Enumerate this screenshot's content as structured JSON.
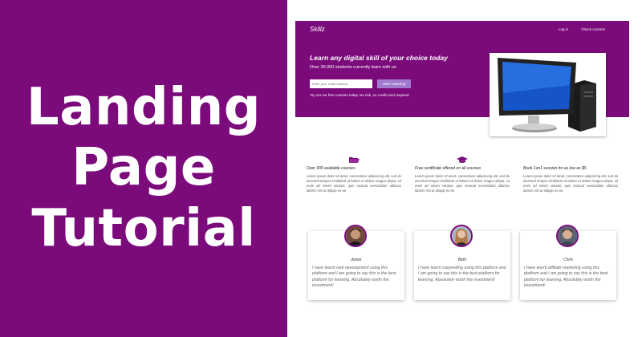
{
  "thumbnail": {
    "title_lines": [
      "Landing",
      "Page",
      "Tutorial"
    ]
  },
  "hero": {
    "brand": "Skillz",
    "nav": [
      "Log in",
      "Check courses"
    ],
    "headline": "Learn any digital skill of your choice today",
    "subheadline": "Over 30,000 students currently learn with us",
    "email_placeholder": "Enter your email address",
    "cta_label": "Start Learning",
    "note": "Try out our free courses today. No risk, no credit card required"
  },
  "features": [
    {
      "icon": "folder-open-icon",
      "title": "Over 300 available courses",
      "text": "Lorem ipsum dolor sit amet, consectetur adipisicing elit, sed do eiusmod tempor incididunt ut labore et dolore magna aliqua. Ut enim ad minim veniam, quis nostrud exercitation ullamco laboris nisi ut aliquip ex ea"
    },
    {
      "icon": "graduation-cap-icon",
      "title": "Free certificate offered on all courses",
      "text": "Lorem ipsum dolor sit amet, consectetur adipisicing elit, sed do eiusmod tempor incididunt ut labore et dolore magna aliqua. Ut enim ad minim veniam, quis nostrud exercitation ullamco laboris nisi ut aliquip ex ea"
    },
    {
      "icon": "",
      "title": "Book 1on1 session for as low as $5",
      "text": "Lorem ipsum dolor sit amet, consectetur adipisicing elit, sed do eiusmod tempor incididunt ut labore et dolore magna aliqua. Ut enim ad minim veniam, quis nostrud exercitation ullamco laboris nisi ut aliquip ex ea"
    }
  ],
  "testimonials": [
    {
      "name": "Aston",
      "quote": "I have learnt web development using this platform and I am going to say this is the best platform for learning. Absolutely worth the investment!"
    },
    {
      "name": "Beth",
      "quote": "I have learnt copywriting using this platform and I am going to say this is the best platform for learning. Absolutely worth the investment!"
    },
    {
      "name": "Chris",
      "quote": "I have learnt affiliate marketing using this platform and I am going to say this is the best platform for learning. Absolutely worth the investment!"
    }
  ],
  "colors": {
    "brand_purple": "#7b0a7b",
    "cta": "#a17ad0"
  }
}
